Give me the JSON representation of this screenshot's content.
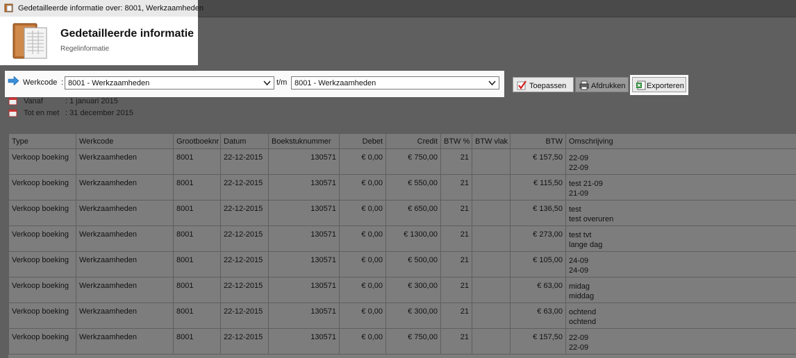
{
  "window": {
    "title": "Gedetailleerde informatie over: 8001, Werkzaamheden"
  },
  "header": {
    "title": "Gedetailleerde informatie",
    "subtitle": "Regelinformatie"
  },
  "filter": {
    "werkcode_label": "Werkcode",
    "colon": ":",
    "from_value": "8001 - Werkzaamheden",
    "to_label": "t/m",
    "to_value": "8001 - Werkzaamheden"
  },
  "toolbar": {
    "apply_label": "Toepassen",
    "print_label": "Afdrukken",
    "export_label": "Exporteren"
  },
  "dates": {
    "from_label": "Vanaf",
    "from_value": ": 1 januari 2015",
    "to_label": "Tot en met",
    "to_value": ": 31 december 2015"
  },
  "table": {
    "columns": [
      "Type",
      "Werkcode",
      "Grootboeknr",
      "Datum",
      "Boekstuknummer",
      "Debet",
      "Credit",
      "BTW %",
      "BTW vlak",
      "BTW",
      "Omschrijving"
    ],
    "rows": [
      {
        "type": "Verkoop boeking",
        "werkcode": "Werkzaamheden",
        "grootboeknr": "8001",
        "datum": "22-12-2015",
        "boekstuk": "130571",
        "debet": "€ 0,00",
        "credit": "€ 750,00",
        "btw_pct": "21",
        "btw_vlak": "",
        "btw": "€ 157,50",
        "omschrijving1": "22-09",
        "omschrijving2": "22-09"
      },
      {
        "type": "Verkoop boeking",
        "werkcode": "Werkzaamheden",
        "grootboeknr": "8001",
        "datum": "22-12-2015",
        "boekstuk": "130571",
        "debet": "€ 0,00",
        "credit": "€ 550,00",
        "btw_pct": "21",
        "btw_vlak": "",
        "btw": "€ 115,50",
        "omschrijving1": "test 21-09",
        "omschrijving2": "21-09"
      },
      {
        "type": "Verkoop boeking",
        "werkcode": "Werkzaamheden",
        "grootboeknr": "8001",
        "datum": "22-12-2015",
        "boekstuk": "130571",
        "debet": "€ 0,00",
        "credit": "€ 650,00",
        "btw_pct": "21",
        "btw_vlak": "",
        "btw": "€ 136,50",
        "omschrijving1": "test",
        "omschrijving2": "test overuren"
      },
      {
        "type": "Verkoop boeking",
        "werkcode": "Werkzaamheden",
        "grootboeknr": "8001",
        "datum": "22-12-2015",
        "boekstuk": "130571",
        "debet": "€ 0,00",
        "credit": "€ 1300,00",
        "btw_pct": "21",
        "btw_vlak": "",
        "btw": "€ 273,00",
        "omschrijving1": "test tvt",
        "omschrijving2": "lange dag"
      },
      {
        "type": "Verkoop boeking",
        "werkcode": "Werkzaamheden",
        "grootboeknr": "8001",
        "datum": "22-12-2015",
        "boekstuk": "130571",
        "debet": "€ 0,00",
        "credit": "€ 500,00",
        "btw_pct": "21",
        "btw_vlak": "",
        "btw": "€ 105,00",
        "omschrijving1": "24-09",
        "omschrijving2": "24-09"
      },
      {
        "type": "Verkoop boeking",
        "werkcode": "Werkzaamheden",
        "grootboeknr": "8001",
        "datum": "22-12-2015",
        "boekstuk": "130571",
        "debet": "€ 0,00",
        "credit": "€ 300,00",
        "btw_pct": "21",
        "btw_vlak": "",
        "btw": "€ 63,00",
        "omschrijving1": "midag",
        "omschrijving2": "middag"
      },
      {
        "type": "Verkoop boeking",
        "werkcode": "Werkzaamheden",
        "grootboeknr": "8001",
        "datum": "22-12-2015",
        "boekstuk": "130571",
        "debet": "€ 0,00",
        "credit": "€ 300,00",
        "btw_pct": "21",
        "btw_vlak": "",
        "btw": "€ 63,00",
        "omschrijving1": "ochtend",
        "omschrijving2": "ochtend"
      },
      {
        "type": "Verkoop boeking",
        "werkcode": "Werkzaamheden",
        "grootboeknr": "8001",
        "datum": "22-12-2015",
        "boekstuk": "130571",
        "debet": "€ 0,00",
        "credit": "€ 750,00",
        "btw_pct": "21",
        "btw_vlak": "",
        "btw": "€ 157,50",
        "omschrijving1": "22-09",
        "omschrijving2": "22-09"
      }
    ]
  },
  "colors": {
    "accent_blue": "#3a8fd8",
    "check_red": "#d42020",
    "excel_green": "#2e8b3a"
  }
}
